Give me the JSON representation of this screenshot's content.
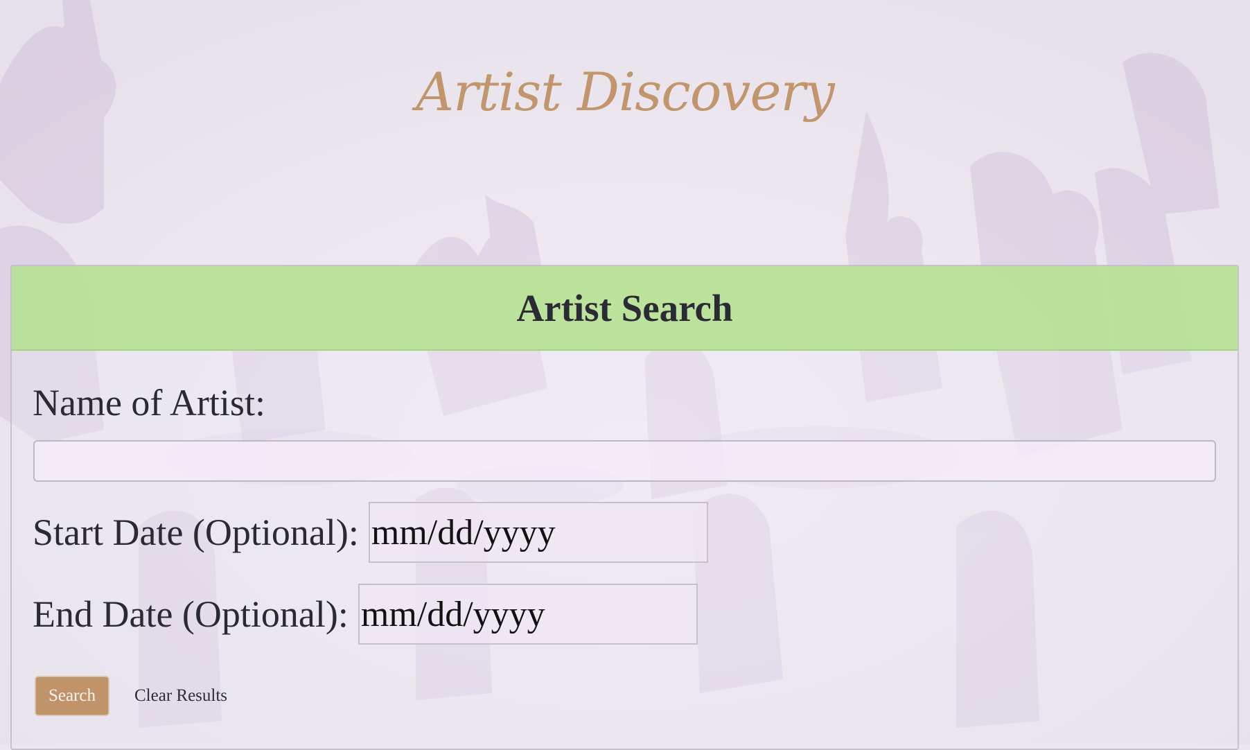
{
  "site": {
    "title": "Artist Discovery"
  },
  "panel": {
    "title": "Artist Search"
  },
  "form": {
    "artist_label": "Name of Artist:",
    "artist_value": "",
    "start_label": "Start Date (Optional):",
    "start_placeholder": "mm/dd/yyyy",
    "end_label": "End Date (Optional):",
    "end_placeholder": "mm/dd/yyyy",
    "search_label": "Search",
    "clear_label": "Clear Results"
  },
  "colors": {
    "title": "#c2966d",
    "header_bg": "#b6e294",
    "button_bg": "#c0936a",
    "background": "#ebe7ef"
  }
}
